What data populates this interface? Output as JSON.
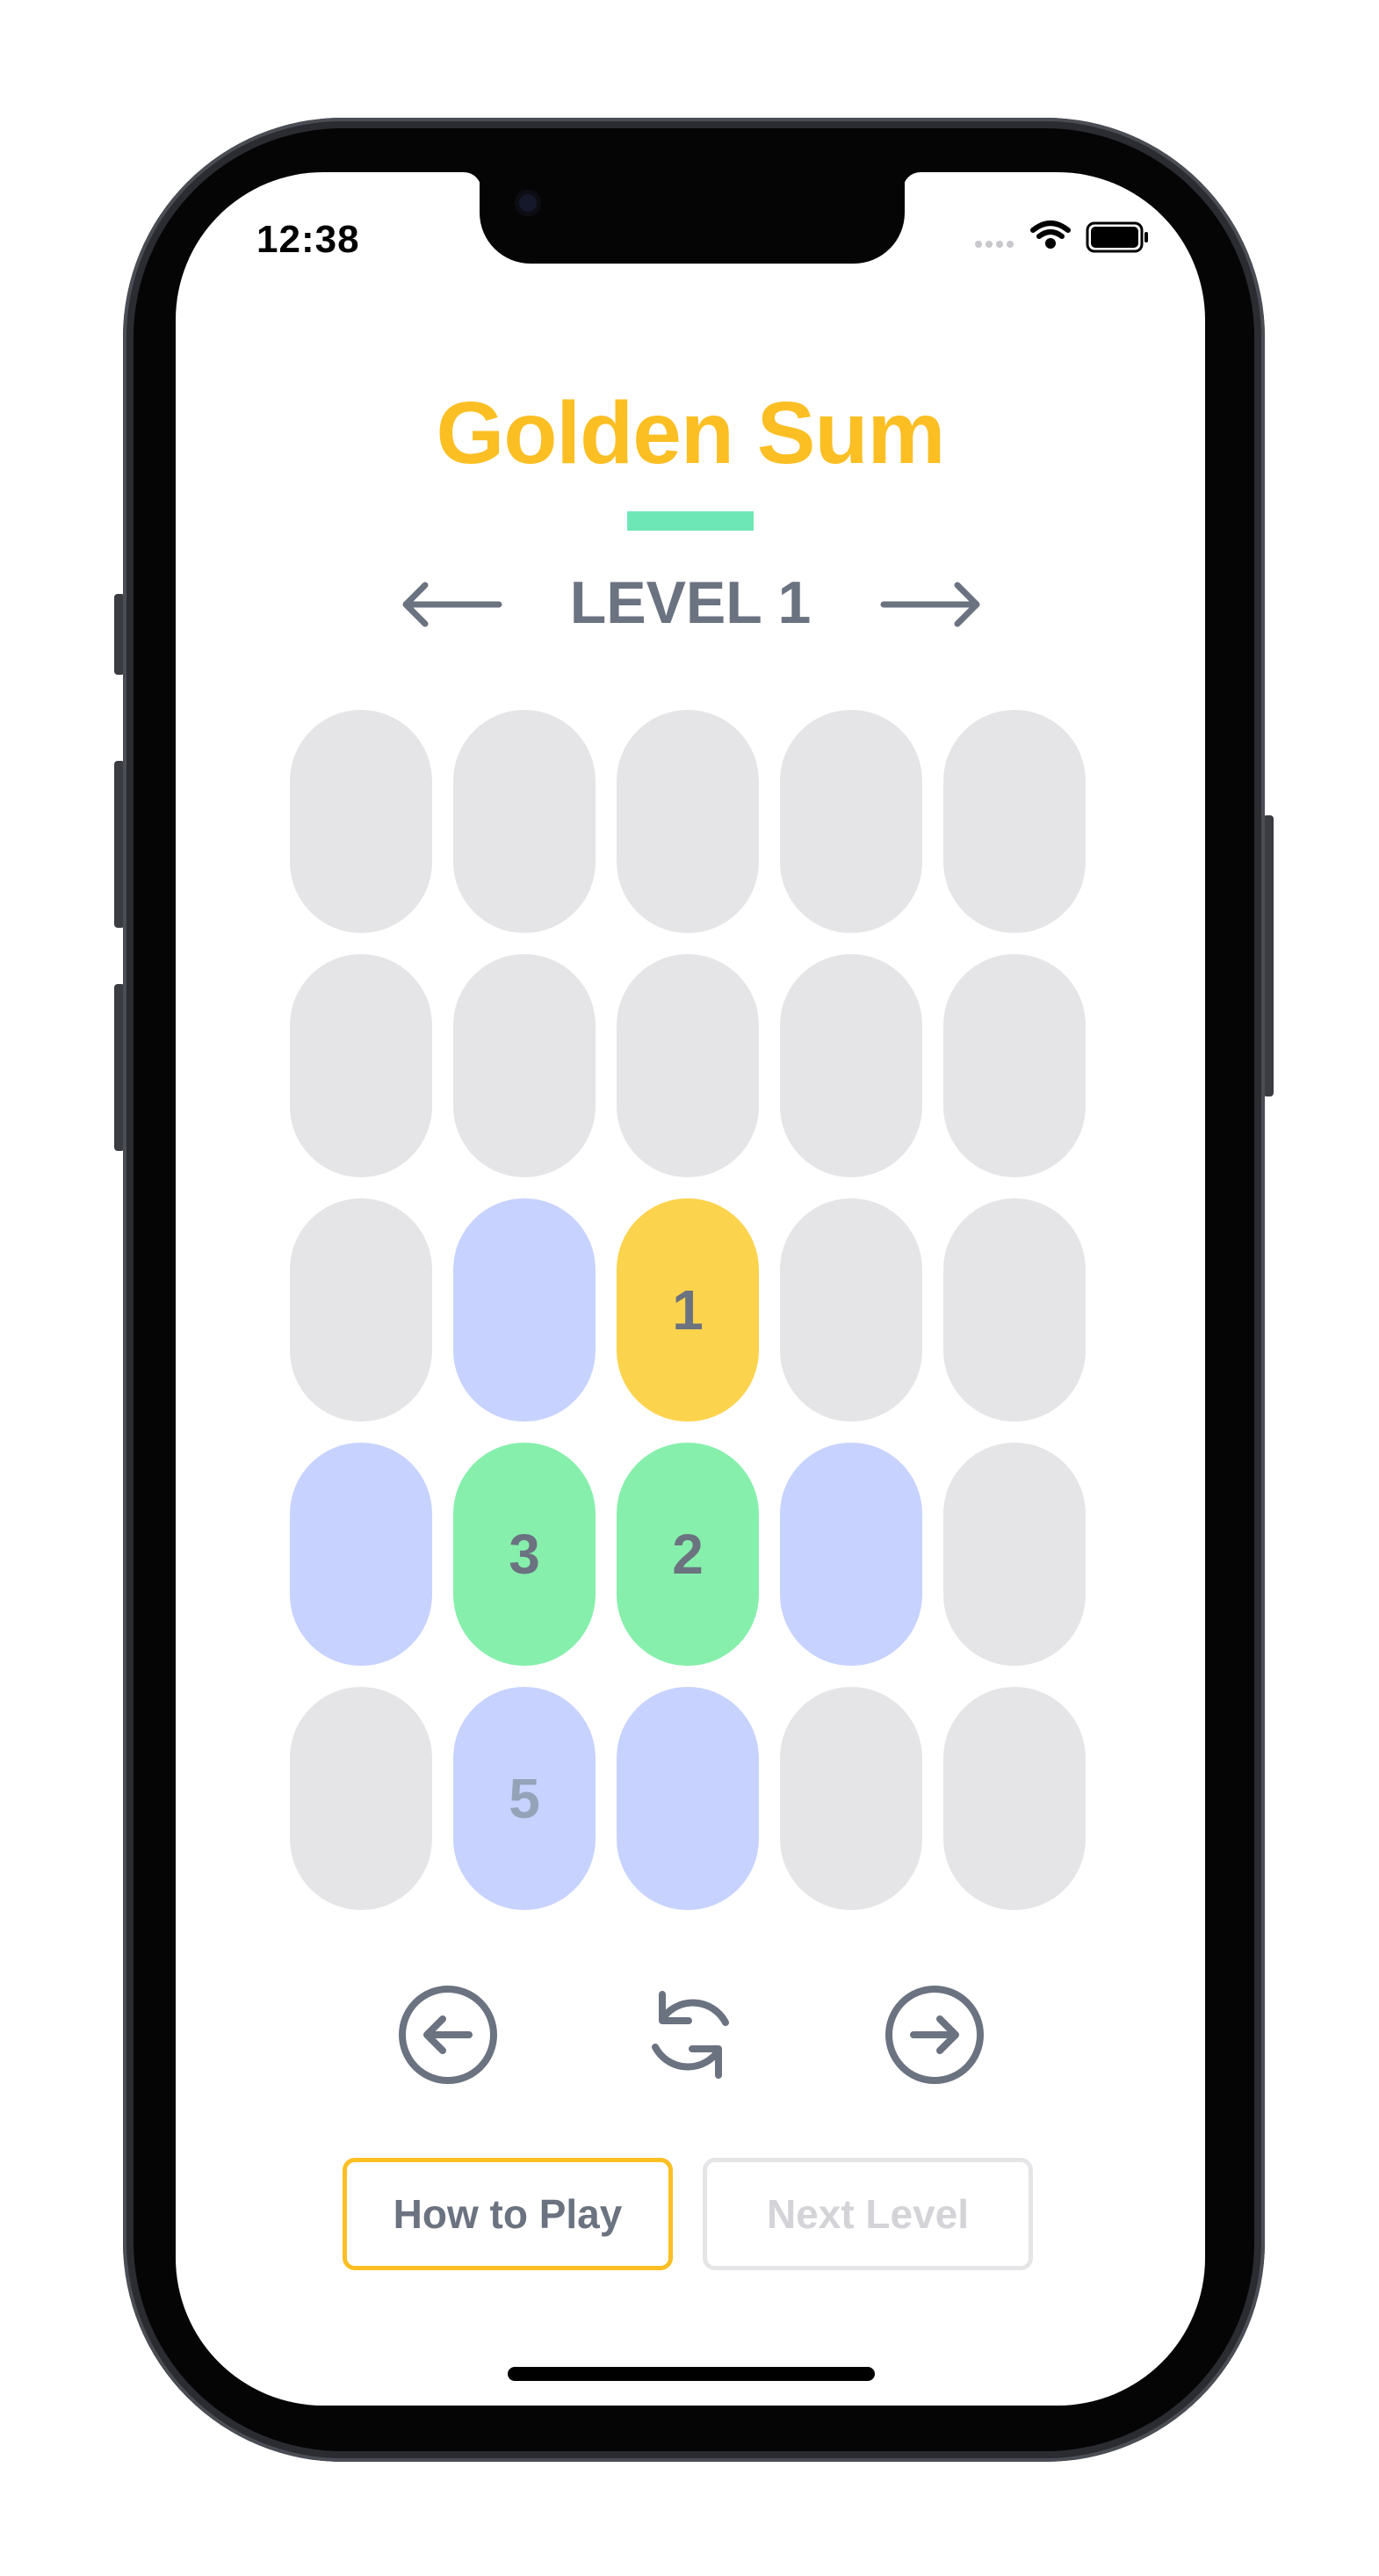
{
  "status_bar": {
    "time": "12:38",
    "icons": [
      "signal-dots-icon",
      "wifi-icon",
      "battery-icon"
    ]
  },
  "game": {
    "title": "Golden Sum",
    "level_label": "LEVEL 1",
    "prev_level_icon": "arrow-left-icon",
    "next_level_icon": "arrow-right-icon"
  },
  "grid": {
    "rows": 5,
    "cols": 5,
    "cells": [
      {
        "value": "",
        "state": "empty"
      },
      {
        "value": "",
        "state": "empty"
      },
      {
        "value": "",
        "state": "empty"
      },
      {
        "value": "",
        "state": "empty"
      },
      {
        "value": "",
        "state": "empty"
      },
      {
        "value": "",
        "state": "empty"
      },
      {
        "value": "",
        "state": "empty"
      },
      {
        "value": "",
        "state": "empty"
      },
      {
        "value": "",
        "state": "empty"
      },
      {
        "value": "",
        "state": "empty"
      },
      {
        "value": "",
        "state": "empty"
      },
      {
        "value": "",
        "state": "available"
      },
      {
        "value": "1",
        "state": "gold"
      },
      {
        "value": "",
        "state": "empty"
      },
      {
        "value": "",
        "state": "empty"
      },
      {
        "value": "",
        "state": "available"
      },
      {
        "value": "3",
        "state": "selected"
      },
      {
        "value": "2",
        "state": "selected"
      },
      {
        "value": "",
        "state": "available"
      },
      {
        "value": "",
        "state": "empty"
      },
      {
        "value": "",
        "state": "empty"
      },
      {
        "value": "5",
        "state": "available"
      },
      {
        "value": "",
        "state": "available"
      },
      {
        "value": "",
        "state": "empty"
      },
      {
        "value": "",
        "state": "empty"
      }
    ]
  },
  "controls": {
    "undo_icon": "circle-arrow-left-icon",
    "reset_icon": "refresh-icon",
    "redo_icon": "circle-arrow-right-icon"
  },
  "buttons": {
    "how_to_play": "How to Play",
    "next_level": "Next Level"
  },
  "colors": {
    "gold": "#fbbf24",
    "gold_cell": "#fcd34d",
    "accent_bar": "#6ee7b7",
    "selected": "#86efac",
    "available": "#c7d2fe",
    "empty": "#e5e5e7",
    "text_gray": "#6b7280",
    "available_text": "#94a3b8",
    "disabled": "#d4d4d8"
  }
}
